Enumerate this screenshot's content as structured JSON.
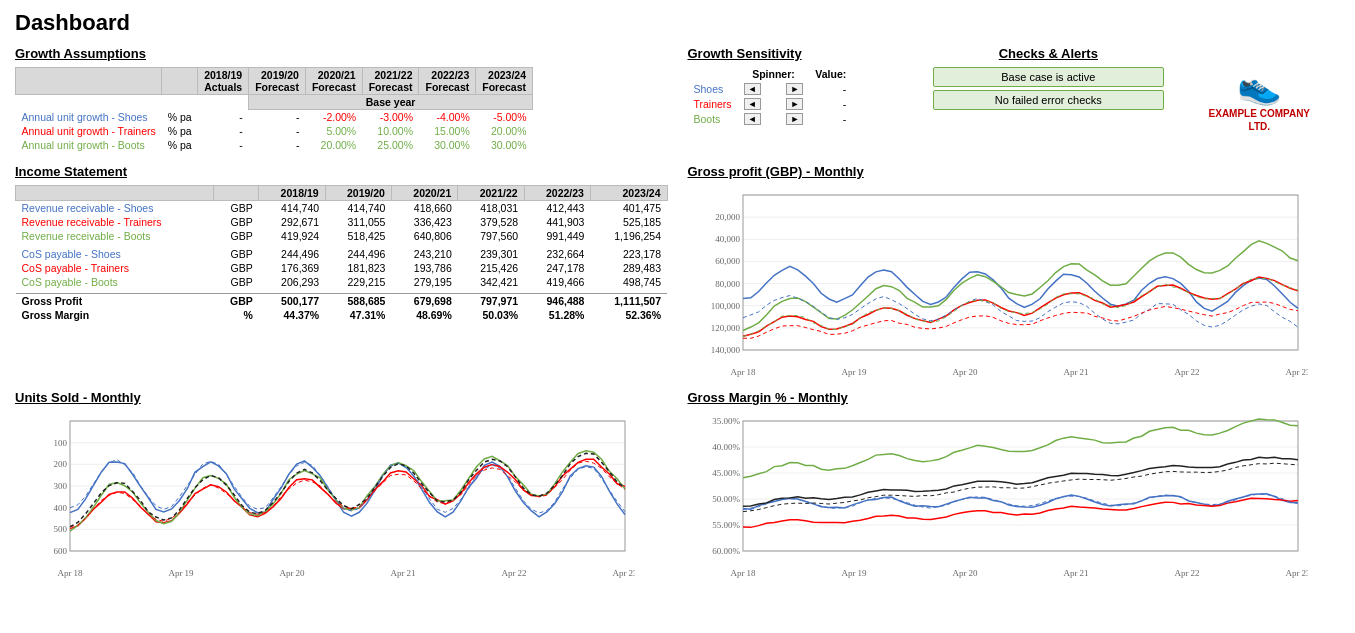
{
  "title": "Dashboard",
  "growth_assumptions": {
    "title": "Growth Assumptions",
    "columns": [
      "",
      "",
      "2018/19\nActuals",
      "2019/20\nForecast",
      "2020/21\nForecast",
      "2021/22\nForecast",
      "2022/23\nForecast",
      "2023/24\nForecast"
    ],
    "base_year_label": "Base year",
    "rows": [
      {
        "label": "Annual unit growth - Shoes",
        "color": "blue",
        "unit": "% pa",
        "vals": [
          "-",
          "-",
          "-2.00%",
          "-3.00%",
          "-4.00%",
          "-5.00%"
        ],
        "val_colors": [
          "dash",
          "dash",
          "neg",
          "neg",
          "neg",
          "neg"
        ]
      },
      {
        "label": "Annual unit growth - Trainers",
        "color": "red",
        "unit": "% pa",
        "vals": [
          "-",
          "-",
          "5.00%",
          "10.00%",
          "15.00%",
          "20.00%"
        ],
        "val_colors": [
          "dash",
          "dash",
          "pos",
          "pos",
          "pos",
          "pos"
        ]
      },
      {
        "label": "Annual unit growth - Boots",
        "color": "green",
        "unit": "% pa",
        "vals": [
          "-",
          "-",
          "20.00%",
          "25.00%",
          "30.00%",
          "30.00%"
        ],
        "val_colors": [
          "dash",
          "dash",
          "pos",
          "pos",
          "pos",
          "pos"
        ]
      }
    ]
  },
  "income_statement": {
    "title": "Income Statement",
    "columns": [
      "",
      "",
      "2018/19",
      "2019/20",
      "2020/21",
      "2021/22",
      "2022/23",
      "2023/24"
    ],
    "rows": [
      {
        "label": "Revenue receivable - Shoes",
        "color": "blue",
        "unit": "GBP",
        "vals": [
          "414,740",
          "414,740",
          "418,660",
          "418,031",
          "412,443",
          "401,475"
        ]
      },
      {
        "label": "Revenue receivable - Trainers",
        "color": "red",
        "unit": "GBP",
        "vals": [
          "292,671",
          "311,055",
          "336,423",
          "379,528",
          "441,903",
          "525,185"
        ]
      },
      {
        "label": "Revenue receivable - Boots",
        "color": "green",
        "unit": "GBP",
        "vals": [
          "419,924",
          "518,425",
          "640,806",
          "797,560",
          "991,449",
          "1,196,254"
        ]
      },
      {
        "label": "",
        "unit": "",
        "vals": [
          "",
          "",
          "",
          "",
          "",
          ""
        ],
        "spacer": true
      },
      {
        "label": "CoS payable - Shoes",
        "color": "blue",
        "unit": "GBP",
        "vals": [
          "244,496",
          "244,496",
          "243,210",
          "239,301",
          "232,664",
          "223,178"
        ]
      },
      {
        "label": "CoS payable - Trainers",
        "color": "red",
        "unit": "GBP",
        "vals": [
          "176,369",
          "181,823",
          "193,786",
          "215,426",
          "247,178",
          "289,483"
        ]
      },
      {
        "label": "CoS payable - Boots",
        "color": "green",
        "unit": "GBP",
        "vals": [
          "206,293",
          "229,215",
          "279,195",
          "342,421",
          "419,466",
          "498,745"
        ]
      },
      {
        "label": "",
        "unit": "",
        "vals": [
          "",
          "",
          "",
          "",
          "",
          ""
        ],
        "spacer": true
      },
      {
        "label": "Gross Profit",
        "color": "black",
        "unit": "GBP",
        "vals": [
          "500,177",
          "588,685",
          "679,698",
          "797,971",
          "946,488",
          "1,111,507"
        ],
        "bold": true
      },
      {
        "label": "Gross Margin",
        "color": "black",
        "unit": "%",
        "vals": [
          "44.37%",
          "47.31%",
          "48.69%",
          "50.03%",
          "51.28%",
          "52.36%"
        ],
        "bold": true
      }
    ]
  },
  "growth_sensitivity": {
    "title": "Growth Sensitivity",
    "spinner_label": "Spinner:",
    "value_label": "Value:",
    "rows": [
      {
        "label": "Shoes",
        "value": "-"
      },
      {
        "label": "Trainers",
        "value": "-"
      },
      {
        "label": "Boots",
        "value": "-"
      }
    ]
  },
  "checks_alerts": {
    "title": "Checks & Alerts",
    "base_case": "Base case is active",
    "no_errors": "No failed error checks"
  },
  "charts": {
    "gross_profit": {
      "title": "Gross profit (GBP) - Monthly"
    },
    "units_sold": {
      "title": "Units Sold - Monthly"
    },
    "gross_margin": {
      "title": "Gross Margin % - Monthly"
    }
  }
}
